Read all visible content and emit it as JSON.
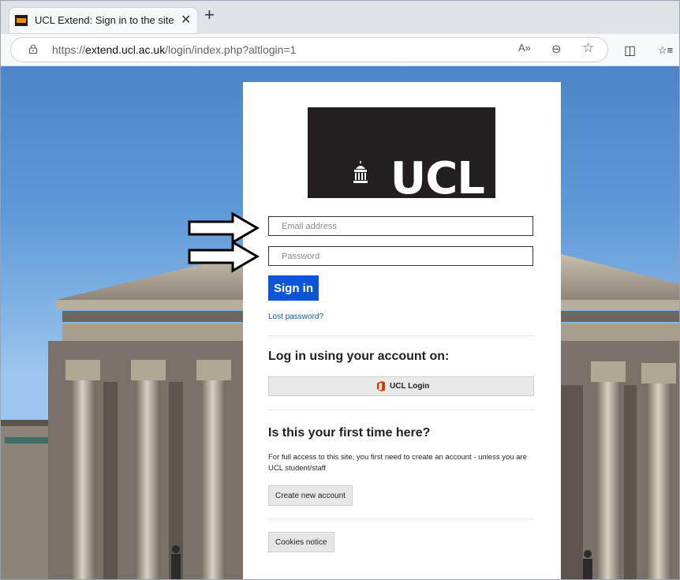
{
  "browser": {
    "tab_title": "UCL Extend: Sign in to the site",
    "tab_close": "✕",
    "new_tab": "+",
    "url_scheme": "https://",
    "url_host": "extend.ucl.ac.uk",
    "url_path": "/login/index.php?altlogin=1",
    "icons": [
      "lock-icon",
      "read-aloud-icon",
      "zoom-icon",
      "favorite-star-icon",
      "split-screen-icon",
      "favorites-list-icon"
    ],
    "read_aloud_glyph": "A»",
    "zoom_glyph": "⊖",
    "star_glyph": "☆",
    "split_glyph": "◫",
    "favorites_glyph": "☆≡"
  },
  "login": {
    "logo_text": "UCL",
    "email_placeholder": "Email address",
    "password_placeholder": "Password",
    "signin_label": "Sign in",
    "lost_password": "Lost password?",
    "sso_heading": "Log in using your account on:",
    "sso_button": "UCL Login",
    "first_time_heading": "Is this your first time here?",
    "first_time_text": "For full access to this site, you first need to create an account - unless you are UCL student/staff",
    "create_account": "Create new account",
    "cookies": "Cookies notice"
  },
  "colors": {
    "primary": "#0c55d8",
    "logo_bg": "#231f20",
    "office_orange": "#d83b01"
  }
}
